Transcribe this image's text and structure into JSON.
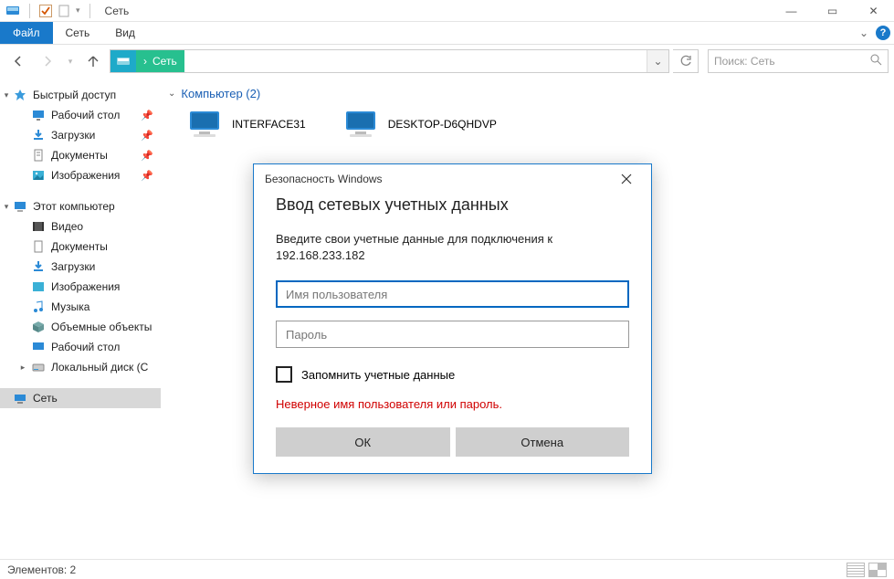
{
  "titlebar": {
    "app_title": "Сеть"
  },
  "win_controls": {
    "min": "—",
    "max": "▭",
    "close": "✕"
  },
  "ribbon": {
    "file": "Файл",
    "tabs": [
      "Сеть",
      "Вид"
    ],
    "help_glyph": "?",
    "expand_glyph": "⌄"
  },
  "navbar": {
    "breadcrumb": "Сеть",
    "arrow_glyph": "›",
    "dropdown_glyph": "⌄",
    "search_placeholder": "Поиск: Сеть"
  },
  "sidebar": {
    "quick_access": "Быстрый доступ",
    "qa_items": [
      {
        "label": "Рабочий стол",
        "icon": "desktop",
        "pinned": true
      },
      {
        "label": "Загрузки",
        "icon": "downloads",
        "pinned": true
      },
      {
        "label": "Документы",
        "icon": "documents",
        "pinned": true
      },
      {
        "label": "Изображения",
        "icon": "pictures",
        "pinned": true
      }
    ],
    "this_pc": "Этот компьютер",
    "pc_items": [
      {
        "label": "Видео",
        "icon": "video"
      },
      {
        "label": "Документы",
        "icon": "documents"
      },
      {
        "label": "Загрузки",
        "icon": "downloads"
      },
      {
        "label": "Изображения",
        "icon": "pictures"
      },
      {
        "label": "Музыка",
        "icon": "music"
      },
      {
        "label": "Объемные объекты",
        "icon": "3d"
      },
      {
        "label": "Рабочий стол",
        "icon": "desktop"
      },
      {
        "label": "Локальный диск (C",
        "icon": "disk"
      }
    ],
    "network": "Сеть"
  },
  "content": {
    "group_label": "Компьютер (2)",
    "computers": [
      {
        "name": "INTERFACE31"
      },
      {
        "name": "DESKTOP-D6QHDVP"
      }
    ]
  },
  "status": {
    "text": "Элементов: 2"
  },
  "dialog": {
    "title": "Безопасность Windows",
    "heading": "Ввод сетевых учетных данных",
    "instruction_prefix": "Введите свои учетные данные для подключения к",
    "target_host": "192.168.233.182",
    "username_placeholder": "Имя пользователя",
    "password_placeholder": "Пароль",
    "remember_label": "Запомнить учетные данные",
    "error_text": "Неверное имя пользователя или пароль.",
    "ok_label": "ОК",
    "cancel_label": "Отмена"
  }
}
